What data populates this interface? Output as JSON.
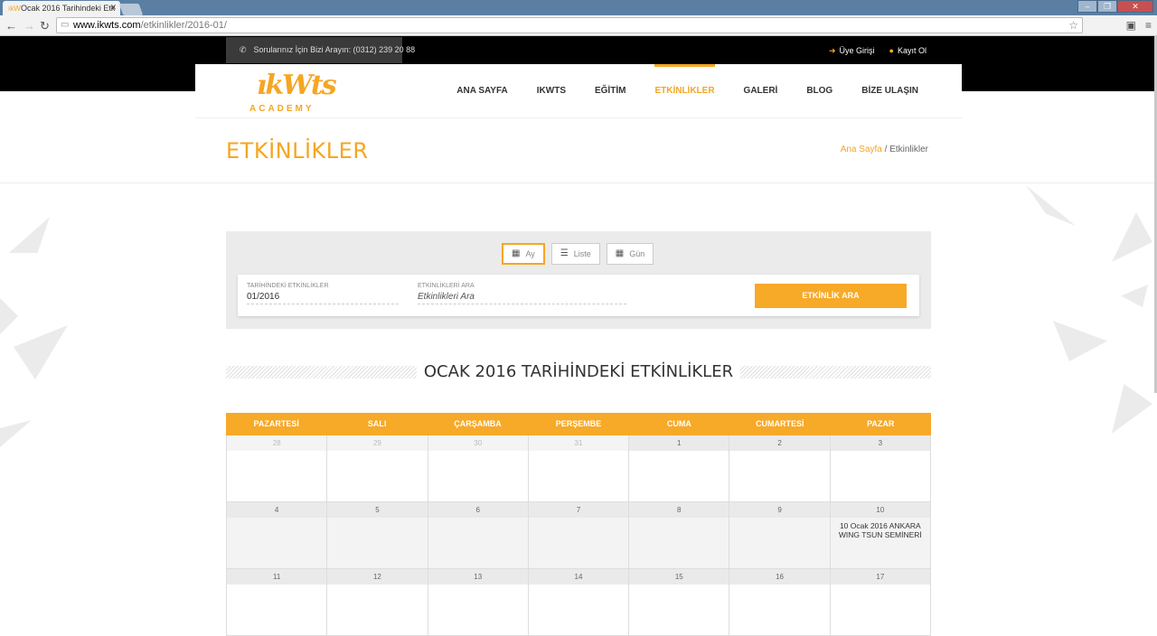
{
  "browser": {
    "tab_title": "Ocak 2016 Tarihindeki Etk",
    "url_domain": "www.ikwts.com",
    "url_path": "/etkinlikler/2016-01/"
  },
  "topbar": {
    "phone_text": "Sorularınız İçin Bizi Arayın: (0312) 239 20 88",
    "login": "Üye Girişi",
    "register": "Kayıt Ol"
  },
  "logo": {
    "script": "ıkWts",
    "text": "ACADEMY"
  },
  "nav": {
    "items": [
      {
        "label": "ANA SAYFA"
      },
      {
        "label": "IKWTS"
      },
      {
        "label": "EĞİTİM"
      },
      {
        "label": "ETKİNLİKLER"
      },
      {
        "label": "GALERİ"
      },
      {
        "label": "BLOG"
      },
      {
        "label": "BİZE ULAŞIN"
      }
    ],
    "active_index": 3
  },
  "page": {
    "title": "ETKİNLİKLER",
    "breadcrumb_home": "Ana Sayfa",
    "breadcrumb_sep": "/",
    "breadcrumb_current": "Etkinlikler"
  },
  "filters": {
    "views": {
      "month": "Ay",
      "list": "Liste",
      "day": "Gün"
    },
    "date_label": "TARİHİNDEKİ ETKİNLİKLER",
    "date_value": "01/2016",
    "search_label": "ETKİNLİKLERİ ARA",
    "search_placeholder": "Etkinlikleri Ara",
    "search_button": "ETKİNLİK ARA"
  },
  "calendar": {
    "heading": "OCAK 2016 TARİHİNDEKİ ETKİNLİKLER",
    "weekdays": [
      "PAZARTESİ",
      "SALI",
      "ÇARŞAMBA",
      "PERŞEMBE",
      "CUMA",
      "CUMARTESİ",
      "PAZAR"
    ],
    "rows": [
      [
        {
          "d": "28",
          "past": true
        },
        {
          "d": "29",
          "past": true
        },
        {
          "d": "30",
          "past": true
        },
        {
          "d": "31",
          "past": true
        },
        {
          "d": "1"
        },
        {
          "d": "2"
        },
        {
          "d": "3"
        }
      ],
      [
        {
          "d": "4"
        },
        {
          "d": "5"
        },
        {
          "d": "6"
        },
        {
          "d": "7"
        },
        {
          "d": "8"
        },
        {
          "d": "9"
        },
        {
          "d": "10",
          "event": "10 Ocak 2016 ANKARA WING TSUN SEMİNERİ"
        }
      ],
      [
        {
          "d": "11"
        },
        {
          "d": "12"
        },
        {
          "d": "13"
        },
        {
          "d": "14"
        },
        {
          "d": "15"
        },
        {
          "d": "16"
        },
        {
          "d": "17"
        }
      ]
    ]
  },
  "colors": {
    "accent": "#f5a623",
    "button": "#f7a928"
  }
}
